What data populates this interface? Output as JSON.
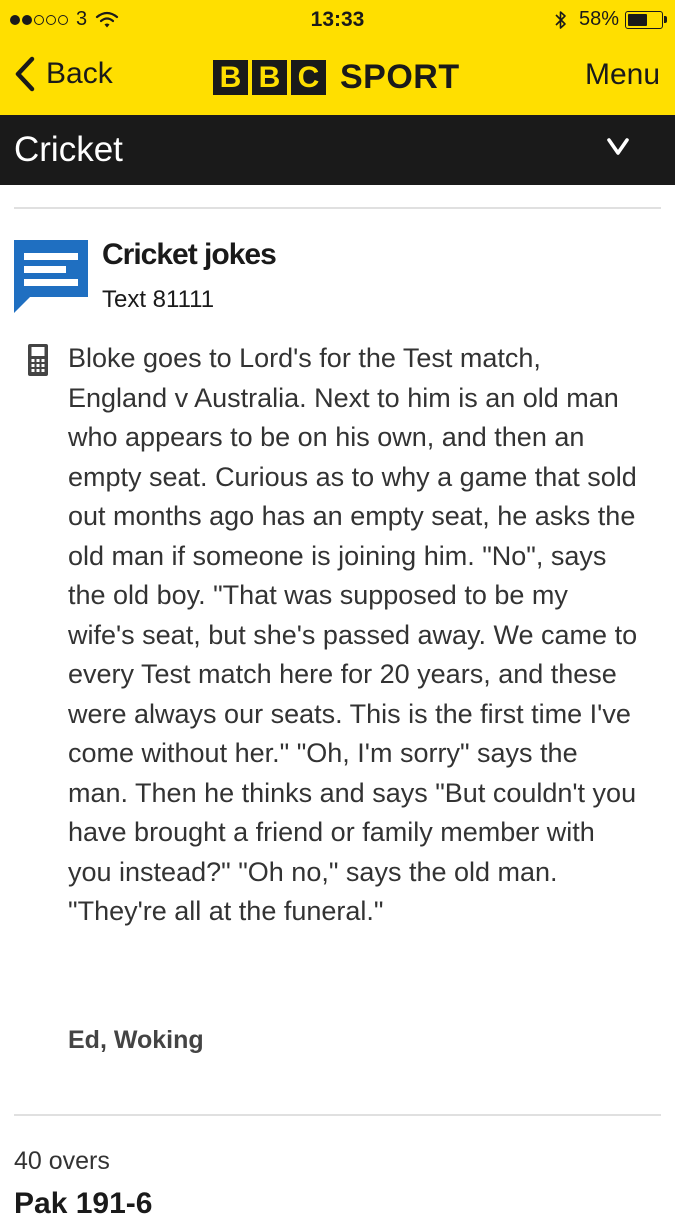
{
  "status_bar": {
    "signal_dots_filled": 2,
    "signal_dots_total": 5,
    "carrier": "3",
    "time": "13:33",
    "battery": "58%",
    "battery_level": 0.58
  },
  "header": {
    "back_label": "Back",
    "logo_letters": [
      "B",
      "B",
      "C"
    ],
    "logo_word": "SPORT",
    "menu_label": "Menu",
    "brand_color": "#ffdf00"
  },
  "section": {
    "title": "Cricket"
  },
  "card": {
    "icon": "comment-icon",
    "title": "Cricket jokes",
    "subtitle": "Text 81111",
    "source_icon": "mobile-phone-icon",
    "body": "Bloke goes to Lord's for the Test match, England v Australia. Next to him is an old man who appears to be on his own, and then an empty seat. Curious as to why a game that sold out months ago has an empty seat, he asks the old man if someone is joining him. \"No\", says the old boy. \"That was supposed to be my wife's seat, but she's passed away. We came to every Test match here for 20 years, and these were always our seats. This is the first time I've come without her.\" \"Oh, I'm sorry\" says the man. Then he thinks and says \"But couldn't you have brought a friend or family member with you instead?\" \"Oh no,\" says the old man. \"They're all at the funeral.\"",
    "author": "Ed, Woking"
  },
  "next_entry": {
    "overs": "40 overs",
    "score": "Pak 191-6"
  },
  "colors": {
    "accent_blue": "#1f6fc1",
    "dark": "#1a1a1a"
  }
}
